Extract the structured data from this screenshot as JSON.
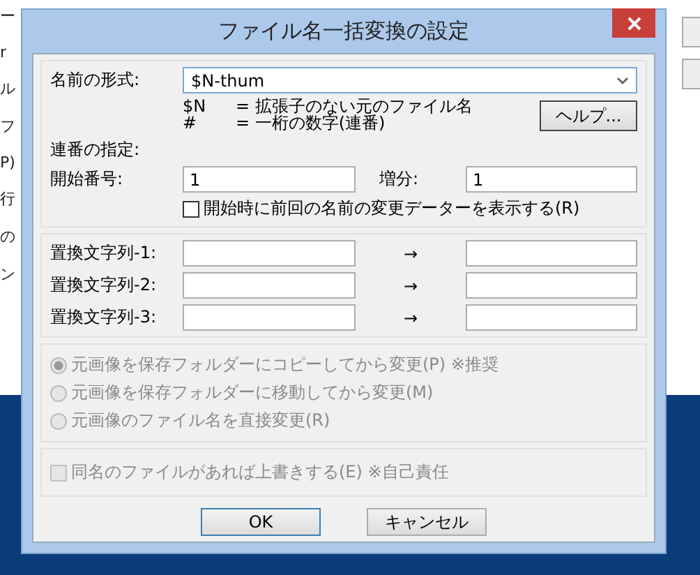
{
  "background_window": {
    "fragments": [
      "ー",
      "r",
      "ル",
      "フ",
      "P)",
      "行",
      "の",
      "ン"
    ]
  },
  "dialog": {
    "title": "ファイル名一括変換の設定",
    "name_format": {
      "label": "名前の形式:",
      "value": "$N-thum"
    },
    "legend": [
      {
        "symbol": "$N",
        "meaning": "= 拡張子のない元のファイル名"
      },
      {
        "symbol": "#",
        "meaning": "= 一桁の数字(連番)"
      }
    ],
    "help_button": "ヘルプ...",
    "sequence": {
      "heading": "連番の指定:",
      "start_label": "開始番号:",
      "start_value": "1",
      "step_label": "増分:",
      "step_value": "1"
    },
    "show_previous": {
      "label": "開始時に前回の名前の変更データーを表示する(R)",
      "checked": false
    },
    "replacements": [
      {
        "label": "置換文字列-1:",
        "arrow": "→"
      },
      {
        "label": "置換文字列-2:",
        "arrow": "→"
      },
      {
        "label": "置換文字列-3:",
        "arrow": "→"
      }
    ],
    "mode_options": [
      {
        "label": "元画像を保存フォルダーにコピーしてから変更(P) ※推奨",
        "selected": true,
        "disabled": true
      },
      {
        "label": "元画像を保存フォルダーに移動してから変更(M)",
        "selected": false,
        "disabled": true
      },
      {
        "label": "元画像のファイル名を直接変更(R)",
        "selected": false,
        "disabled": true
      }
    ],
    "overwrite": {
      "label": "同名のファイルがあれば上書きする(E) ※自己責任",
      "checked": false,
      "disabled": true
    },
    "buttons": [
      {
        "label": "OK",
        "default": true
      },
      {
        "label": "キャンセル",
        "default": false
      }
    ]
  }
}
